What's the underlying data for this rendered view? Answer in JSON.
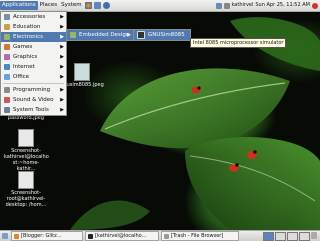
{
  "top_panel": {
    "menus": [
      "Applications",
      "Places",
      "System"
    ],
    "user": "kathirvel",
    "clock": "Sun Apr 25, 11:52 AM"
  },
  "applications_menu": {
    "items": [
      {
        "label": "Accessories",
        "icon": "accessories-icon"
      },
      {
        "label": "Education",
        "icon": "education-icon"
      },
      {
        "label": "Electronics",
        "icon": "electronics-icon",
        "highlighted": true
      },
      {
        "label": "Games",
        "icon": "games-icon"
      },
      {
        "label": "Graphics",
        "icon": "graphics-icon"
      },
      {
        "label": "Internet",
        "icon": "internet-icon"
      },
      {
        "label": "Office",
        "icon": "office-icon"
      },
      {
        "label": "Programming",
        "icon": "programming-icon"
      },
      {
        "label": "Sound & Video",
        "icon": "sound-video-icon"
      },
      {
        "label": "System Tools",
        "icon": "system-tools-icon"
      }
    ]
  },
  "electronics_submenu": {
    "items": [
      {
        "label": "Embedded Design"
      }
    ]
  },
  "embedded_submenu": {
    "items": [
      {
        "label": "GNUSim8085"
      }
    ]
  },
  "tooltip": "Intel 8085 microprocessor simulator",
  "desktop_icons": [
    {
      "label": "gnusim8085.jpeg"
    },
    {
      "label": "enable password.jpeg"
    },
    {
      "label": "Screenshot-kathirvel@localho st:~home-kathir..."
    },
    {
      "label": "Screenshot-root@kathirvel-desktop: /hom..."
    }
  ],
  "taskbar": {
    "items": [
      {
        "label": "[Blogger: Glitz..."
      },
      {
        "label": "[kathirvel@localho..."
      },
      {
        "label": "[Trash - File Browser]"
      }
    ]
  },
  "colors": {
    "menu_highlight": "#4f79b0",
    "panel": "#e4e4e1",
    "tooltip_bg": "#fffde0"
  }
}
